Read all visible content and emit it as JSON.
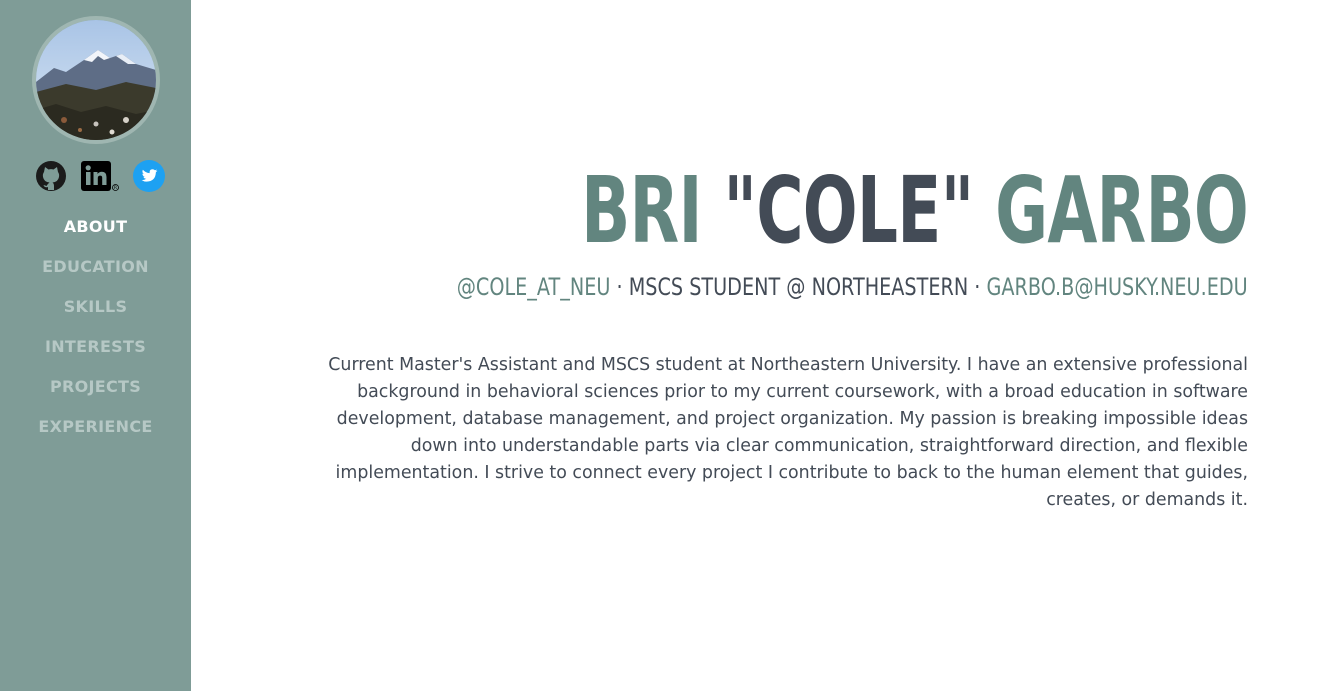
{
  "sidebar": {
    "avatar_alt": "",
    "social": [
      {
        "name": "github-icon"
      },
      {
        "name": "linkedin-icon"
      },
      {
        "name": "twitter-icon"
      }
    ],
    "nav": [
      {
        "label": "ABOUT",
        "active": true
      },
      {
        "label": "EDUCATION",
        "active": false
      },
      {
        "label": "SKILLS",
        "active": false
      },
      {
        "label": "INTERESTS",
        "active": false
      },
      {
        "label": "PROJECTS",
        "active": false
      },
      {
        "label": "EXPERIENCE",
        "active": false
      }
    ]
  },
  "header": {
    "first": "BRI",
    "nick": "\"COLE\"",
    "last": "GARBO",
    "handle": "@COLE_AT_NEU",
    "separator": "·",
    "role": "MSCS STUDENT @ NORTHEASTERN",
    "email": "GARBO.B@HUSKY.NEU.EDU"
  },
  "about": {
    "bio": "Current Master's Assistant and MSCS student at Northeastern University. I have an extensive professional background in behavioral sciences prior to my current coursework, with a broad education in software development, database management, and project organization. My passion is breaking impossible ideas down into understandable parts via clear communication, straightforward direction, and flexible implementation. I strive to connect every project I contribute to back to the human element that guides, creates, or demands it."
  },
  "colors": {
    "sidebar": "#7f9c97",
    "accent": "#62857f",
    "dark": "#434b56",
    "nav_inactive": "#b6c8c5",
    "twitter": "#1da1f2"
  }
}
